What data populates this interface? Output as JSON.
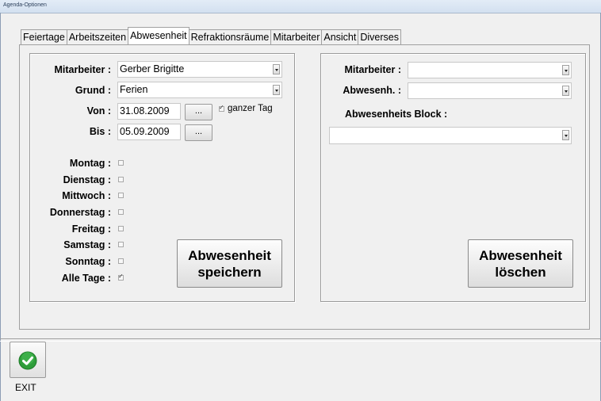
{
  "window": {
    "title": "Agenda-Optionen"
  },
  "tabs": [
    {
      "label": "Feiertage"
    },
    {
      "label": "Arbeitszeiten"
    },
    {
      "label": "Abwesenheit"
    },
    {
      "label": "Refraktionsräume"
    },
    {
      "label": "Mitarbeiter"
    },
    {
      "label": "Ansicht"
    },
    {
      "label": "Diverses"
    }
  ],
  "active_tab": "Abwesenheit",
  "left": {
    "mitarbeiter_label": "Mitarbeiter :",
    "mitarbeiter_value": "Gerber Brigitte",
    "grund_label": "Grund :",
    "grund_value": "Ferien",
    "von_label": "Von :",
    "von_value": "31.08.2009",
    "bis_label": "Bis :",
    "bis_value": "05.09.2009",
    "dots_label": "...",
    "ganzer_tag_label": "ganzer Tag",
    "ganzer_tag_checked": true,
    "days": [
      {
        "label": "Montag :",
        "checked": false
      },
      {
        "label": "Dienstag :",
        "checked": false
      },
      {
        "label": "Mittwoch :",
        "checked": false
      },
      {
        "label": "Donnerstag :",
        "checked": false
      },
      {
        "label": "Freitag :",
        "checked": false
      },
      {
        "label": "Samstag :",
        "checked": false
      },
      {
        "label": "Sonntag :",
        "checked": false
      },
      {
        "label": "Alle Tage :",
        "checked": true
      }
    ],
    "save_button_line1": "Abwesenheit",
    "save_button_line2": "speichern"
  },
  "right": {
    "mitarbeiter_label": "Mitarbeiter :",
    "mitarbeiter_value": "",
    "abwesenh_label": "Abwesenh. :",
    "abwesenh_value": "",
    "block_label": "Abwesenheits Block :",
    "block_value": "",
    "delete_button_line1": "Abwesenheit",
    "delete_button_line2": "löschen"
  },
  "footer": {
    "exit_label": "EXIT",
    "exit_icon": "green-check-icon",
    "exit_icon_color": "#2e9d3a"
  }
}
